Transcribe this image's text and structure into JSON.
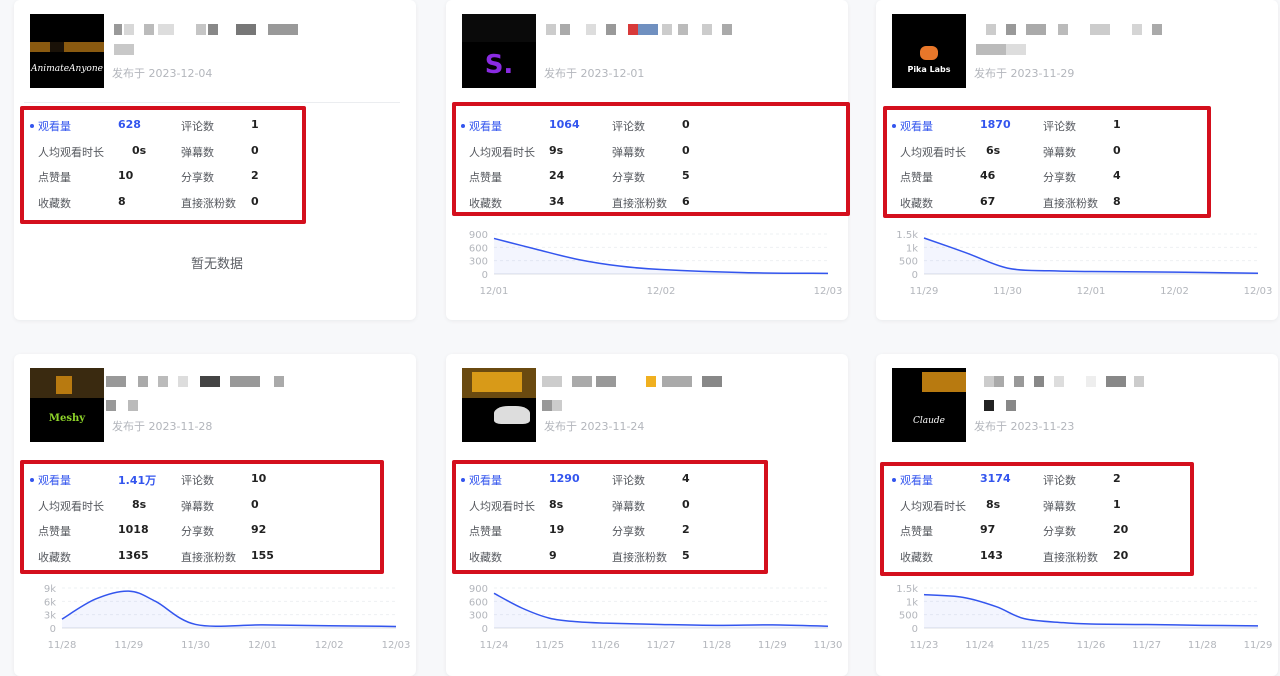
{
  "labels": {
    "views": "观看量",
    "comments": "评论数",
    "avg_watch": "人均观看时长",
    "danmaku": "弹幕数",
    "likes": "点赞量",
    "shares": "分享数",
    "favorites": "收藏数",
    "followers": "直接涨粉数",
    "no_data": "暂无数据"
  },
  "colors": {
    "accent": "#3355ee",
    "highlight_box": "#d40f1d",
    "curve": "#3355ee"
  },
  "cards": [
    {
      "thumb_label": "AnimateAnyone",
      "published": "发布于 2023-12-04",
      "stats": {
        "views": "628",
        "comments": "1",
        "avg_watch": "0s",
        "danmaku": "0",
        "likes": "10",
        "shares": "2",
        "favorites": "8",
        "followers": "0"
      },
      "has_chart": false
    },
    {
      "thumb_label": "S.",
      "published": "发布于 2023-12-01",
      "stats": {
        "views": "1064",
        "comments": "0",
        "avg_watch": "9s",
        "danmaku": "0",
        "likes": "24",
        "shares": "5",
        "favorites": "34",
        "followers": "6"
      },
      "has_chart": true
    },
    {
      "thumb_label": "Pika Labs",
      "published": "发布于 2023-11-29",
      "stats": {
        "views": "1870",
        "comments": "1",
        "avg_watch": "6s",
        "danmaku": "0",
        "likes": "46",
        "shares": "4",
        "favorites": "67",
        "followers": "8"
      },
      "has_chart": true
    },
    {
      "thumb_label": "Meshy",
      "published": "发布于 2023-11-28",
      "stats": {
        "views": "1.41万",
        "comments": "10",
        "avg_watch": "8s",
        "danmaku": "0",
        "likes": "1018",
        "shares": "92",
        "favorites": "1365",
        "followers": "155"
      },
      "has_chart": true
    },
    {
      "thumb_label": "",
      "published": "发布于 2023-11-24",
      "stats": {
        "views": "1290",
        "comments": "4",
        "avg_watch": "8s",
        "danmaku": "0",
        "likes": "19",
        "shares": "2",
        "favorites": "9",
        "followers": "5"
      },
      "has_chart": true
    },
    {
      "thumb_label": "Claude",
      "published": "发布于 2023-11-23",
      "stats": {
        "views": "3174",
        "comments": "2",
        "avg_watch": "8s",
        "danmaku": "1",
        "likes": "97",
        "shares": "20",
        "favorites": "143",
        "followers": "20"
      },
      "has_chart": true
    }
  ],
  "chart_data": [
    {
      "type": "area",
      "title": "",
      "x": [
        "12/01",
        "12/02",
        "12/03"
      ],
      "points": [
        [
          0,
          800
        ],
        [
          0.25,
          560
        ],
        [
          0.5,
          330
        ],
        [
          0.75,
          180
        ],
        [
          1.0,
          100
        ],
        [
          1.5,
          30
        ],
        [
          2.0,
          15
        ]
      ],
      "ylim": [
        0,
        900
      ],
      "yticks": [
        "900",
        "600",
        "300",
        "0"
      ]
    },
    {
      "type": "area",
      "title": "",
      "x": [
        "11/29",
        "11/30",
        "12/01",
        "12/02",
        "12/03"
      ],
      "points": [
        [
          0,
          1350
        ],
        [
          0.5,
          800
        ],
        [
          1,
          220
        ],
        [
          1.5,
          120
        ],
        [
          2,
          95
        ],
        [
          3,
          70
        ],
        [
          4,
          30
        ]
      ],
      "ylim": [
        0,
        1500
      ],
      "yticks": [
        "1.5k",
        "1k",
        "500",
        "0"
      ]
    },
    {
      "type": "area",
      "title": "",
      "x": [
        "11/28",
        "11/29",
        "11/30",
        "12/01",
        "12/02",
        "12/03"
      ],
      "points": [
        [
          0,
          2000
        ],
        [
          0.5,
          6500
        ],
        [
          1,
          8300
        ],
        [
          1.4,
          6000
        ],
        [
          2,
          800
        ],
        [
          3,
          700
        ],
        [
          4,
          500
        ],
        [
          5,
          350
        ]
      ],
      "ylim": [
        0,
        9000
      ],
      "yticks": [
        "9k",
        "6k",
        "3k",
        "0"
      ]
    },
    {
      "type": "area",
      "title": "",
      "x": [
        "11/24",
        "11/25",
        "11/26",
        "11/27",
        "11/28",
        "11/29",
        "11/30"
      ],
      "points": [
        [
          0,
          780
        ],
        [
          0.5,
          450
        ],
        [
          1,
          220
        ],
        [
          1.5,
          140
        ],
        [
          2,
          110
        ],
        [
          3,
          80
        ],
        [
          4,
          60
        ],
        [
          5,
          70
        ],
        [
          6,
          40
        ]
      ],
      "ylim": [
        0,
        900
      ],
      "yticks": [
        "900",
        "600",
        "300",
        "0"
      ]
    },
    {
      "type": "area",
      "title": "",
      "x": [
        "11/23",
        "11/24",
        "11/25",
        "11/26",
        "11/27",
        "11/28",
        "11/29"
      ],
      "points": [
        [
          0,
          1250
        ],
        [
          0.7,
          1150
        ],
        [
          1.3,
          800
        ],
        [
          1.8,
          350
        ],
        [
          2.5,
          200
        ],
        [
          3,
          150
        ],
        [
          4,
          130
        ],
        [
          5,
          100
        ],
        [
          6,
          80
        ]
      ],
      "ylim": [
        0,
        1500
      ],
      "yticks": [
        "1.5k",
        "1k",
        "500",
        "0"
      ]
    }
  ]
}
